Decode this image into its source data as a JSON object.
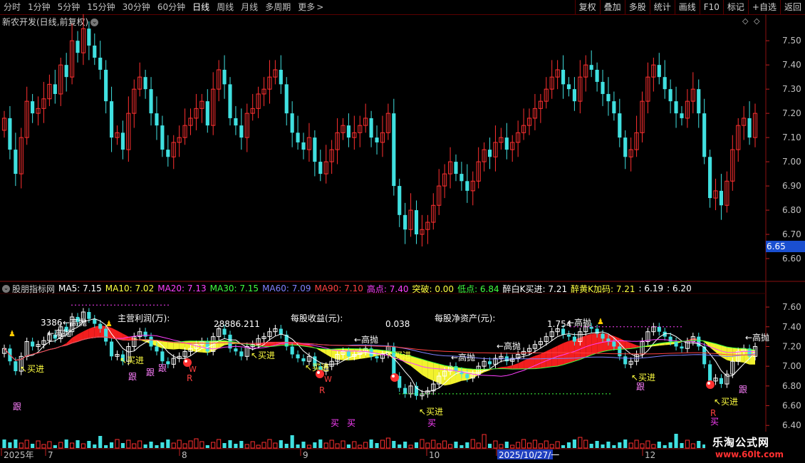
{
  "toolbar": {
    "tabs": [
      "分时",
      "1分钟",
      "5分钟",
      "15分钟",
      "30分钟",
      "60分钟",
      "日线",
      "周线",
      "月线",
      "多周期",
      "更多"
    ],
    "active_tab": "日线",
    "right_buttons": [
      "复权",
      "叠加",
      "多股",
      "统计",
      "画线",
      "F10",
      "标记",
      "+自选",
      "返回"
    ]
  },
  "main_chart": {
    "title": "新农开发(日线,前复权)",
    "price_ticks": [
      "7.50",
      "7.40",
      "7.30",
      "7.20",
      "7.10",
      "7.00",
      "6.90",
      "6.80",
      "6.70",
      "6.60"
    ],
    "current_price": "6.65",
    "current_price_color": "#1a4fd0"
  },
  "indicator": {
    "name": "股朋指标网",
    "values": [
      {
        "label": "MA5: 7.15",
        "color": "#ffffff"
      },
      {
        "label": "MA10: 7.02",
        "color": "#ffff40"
      },
      {
        "label": "MA20: 7.13",
        "color": "#ff40ff"
      },
      {
        "label": "MA30: 7.15",
        "color": "#40ff40"
      },
      {
        "label": "MA60: 7.09",
        "color": "#8080ff"
      },
      {
        "label": "MA90: 7.10",
        "color": "#ff4040"
      },
      {
        "label": "高点: 7.40",
        "color": "#ff40ff"
      },
      {
        "label": "突破: 0.00",
        "color": "#ffff40"
      },
      {
        "label": "低点: 6.84",
        "color": "#40ff40"
      },
      {
        "label": "醉白K买进: 7.21",
        "color": "#ffffff"
      },
      {
        "label": "醉黄K加码: 7.21",
        "color": "#ffff40"
      },
      {
        "label": ": 6.19",
        "color": "#ffffff"
      },
      {
        "label": ": 6.20",
        "color": "#ffffff"
      }
    ],
    "price_ticks": [
      "7.60",
      "7.40",
      "7.20",
      "7.00",
      "6.80",
      "6.60",
      "6.40"
    ],
    "annotations": {
      "revenue_label": "主营利润(万):",
      "revenue_value": "28886.211",
      "eps_label": "每股收益(元):",
      "eps_value": "0.038",
      "navps_label": "每股净资产(元):",
      "navps_value": "1.754",
      "left_value": "3386",
      "high_sell": "←高抛",
      "buy_in": "↖买进",
      "follow": "跟",
      "buy": "买",
      "w": "W",
      "r": "R"
    }
  },
  "date_axis": {
    "labels": [
      "2025年",
      "7",
      "8",
      "9",
      "10",
      "2025/10/27/一",
      "12"
    ]
  },
  "logo": {
    "line1": "乐淘公式网",
    "line2": "www.60lt.com"
  }
}
